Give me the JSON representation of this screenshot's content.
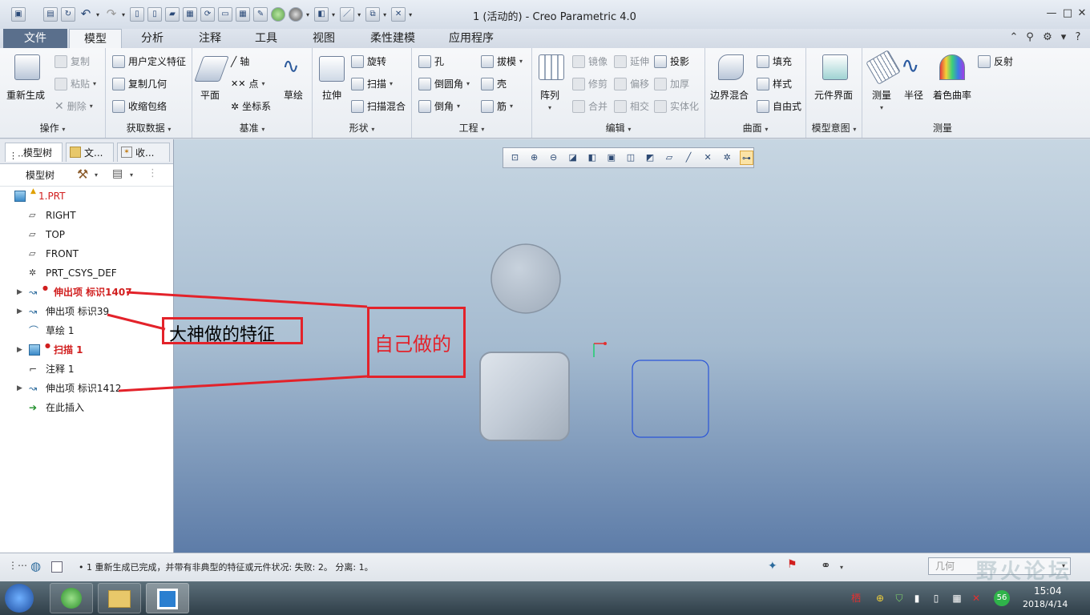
{
  "window": {
    "title": "1 (活动的) - Creo Parametric 4.0",
    "controls": {
      "minimize": "—",
      "maximize": "□",
      "close": "✕"
    }
  },
  "tabs": [
    {
      "label": "文件"
    },
    {
      "label": "模型"
    },
    {
      "label": "分析"
    },
    {
      "label": "注释"
    },
    {
      "label": "工具"
    },
    {
      "label": "视图"
    },
    {
      "label": "柔性建模"
    },
    {
      "label": "应用程序"
    }
  ],
  "ribbon": {
    "ops": {
      "label": "操作",
      "regen": "重新生成",
      "copy": "复制",
      "paste": "粘贴",
      "delete": "删除"
    },
    "getdata": {
      "label": "获取数据",
      "udf": "用户定义特征",
      "copygeom": "复制几何",
      "shrinkwrap": "收缩包络"
    },
    "datum": {
      "label": "基准",
      "plane": "平面",
      "axis": "轴",
      "point": "点",
      "csys": "坐标系",
      "sketch": "草绘"
    },
    "shapes": {
      "label": "形状",
      "extrude": "拉伸",
      "revolve": "旋转",
      "sweep": "扫描",
      "sweptblend": "扫描混合"
    },
    "eng": {
      "label": "工程",
      "hole": "孔",
      "round": "倒圆角",
      "chamfer": "倒角",
      "draft": "拔模",
      "shell": "壳",
      "rib": "筋"
    },
    "edit": {
      "label": "编辑",
      "pattern": "阵列",
      "mirror": "镜像",
      "trim": "修剪",
      "merge": "合并",
      "extend": "延伸",
      "offset": "偏移",
      "intersect": "相交",
      "project": "投影",
      "thicken": "加厚",
      "solidify": "实体化"
    },
    "surfaces": {
      "label": "曲面",
      "boundary": "边界混合",
      "fill": "填充",
      "style": "样式",
      "freestyle": "自由式"
    },
    "intent": {
      "label": "模型意图",
      "compint": "元件界面"
    },
    "measure": {
      "label": "测量",
      "measure": "测量",
      "radius": "半径",
      "curvature": "着色曲率",
      "reflect": "反射"
    }
  },
  "leftpanel": {
    "tabs": [
      "模型树",
      "文...",
      "收..."
    ],
    "toolbar_label": "模型树",
    "tree": [
      {
        "label": "1.PRT",
        "red": true
      },
      {
        "label": "RIGHT"
      },
      {
        "label": "TOP"
      },
      {
        "label": "FRONT"
      },
      {
        "label": "PRT_CSYS_DEF"
      },
      {
        "label": "伸出项 标识1407",
        "red": true,
        "expand": true
      },
      {
        "label": "伸出项 标识39",
        "expand": true
      },
      {
        "label": "草绘 1"
      },
      {
        "label": "扫描 1",
        "red": true,
        "expand": true
      },
      {
        "label": "注释 1"
      },
      {
        "label": "伸出项 标识1412",
        "expand": true
      },
      {
        "label": "在此插入"
      }
    ]
  },
  "annotations": {
    "left_text": "大神做的特征",
    "right_text": "自己做的",
    "color": "#e3222a"
  },
  "status": {
    "message": "• 1 重新生成已完成，并带有非典型的特征或元件状况: 失败: 2。 分离: 1。",
    "filter": "几何",
    "watermark": "野火论坛"
  },
  "taskbar": {
    "time": "15:04",
    "date": "2018/4/14"
  }
}
